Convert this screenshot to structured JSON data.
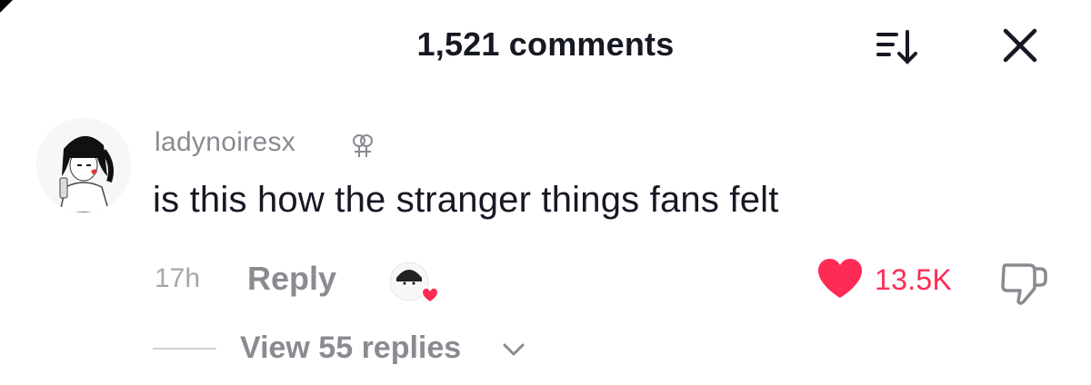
{
  "header": {
    "comment_count_label": "1,521 comments",
    "sort_icon": "sort-list-icon",
    "close_icon": "close-icon"
  },
  "comment": {
    "username": "ladynoiresx",
    "username_badge_icon": "gender-symbol-icon",
    "text": "is this how the stranger things fans felt",
    "time": "17h",
    "reply_label": "Reply",
    "like_count": "13.5K",
    "liked": true,
    "view_replies_label": "View 55 replies"
  },
  "colors": {
    "like_red": "#fe2c55",
    "muted_text": "#8a8b91",
    "primary_text": "#161823"
  }
}
